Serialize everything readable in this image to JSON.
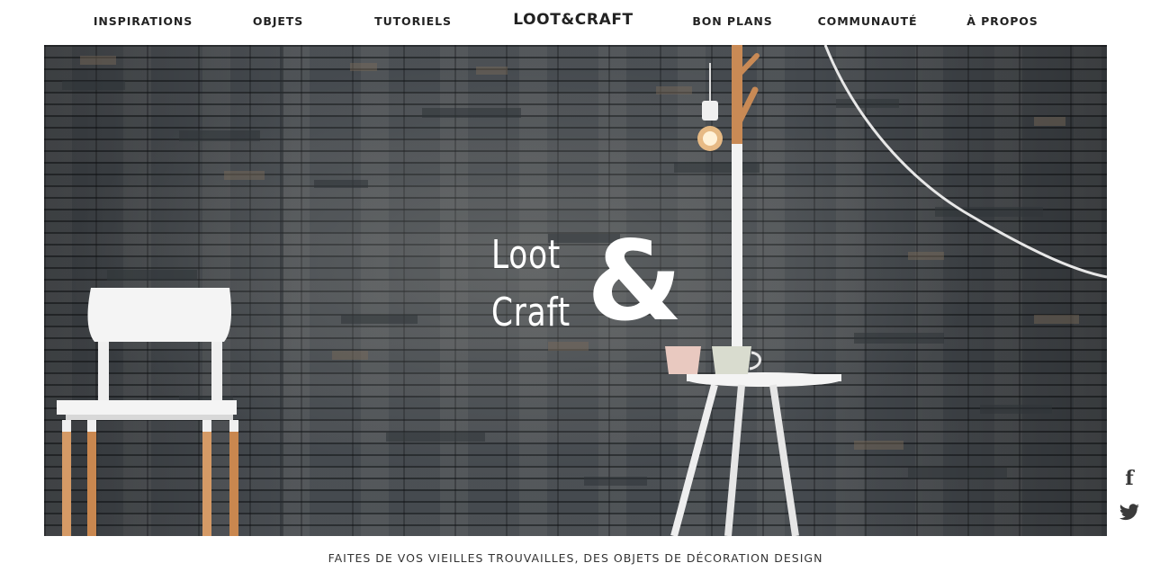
{
  "nav": {
    "items": [
      {
        "label": "INSPIRATIONS"
      },
      {
        "label": "OBJETS"
      },
      {
        "label": "TUTORIELS"
      },
      {
        "label": "BON PLANS"
      },
      {
        "label": "COMMUNAUTÉ"
      },
      {
        "label": "À PROPOS"
      }
    ],
    "logo": "LOOT&CRAFT"
  },
  "hero": {
    "word_1": "Loot",
    "word_2": "Craft",
    "ampersand": "&"
  },
  "social": {
    "facebook": "f",
    "facebook_icon": "facebook-icon",
    "twitter_icon": "twitter-icon"
  },
  "tagline": "FAITES DE VOS VIEILLES TROUVAILLES, DES OBJETS DE DÉCORATION DESIGN",
  "colors": {
    "wall": "#454a4f",
    "text": "#222222",
    "hero_text": "#ffffff"
  }
}
